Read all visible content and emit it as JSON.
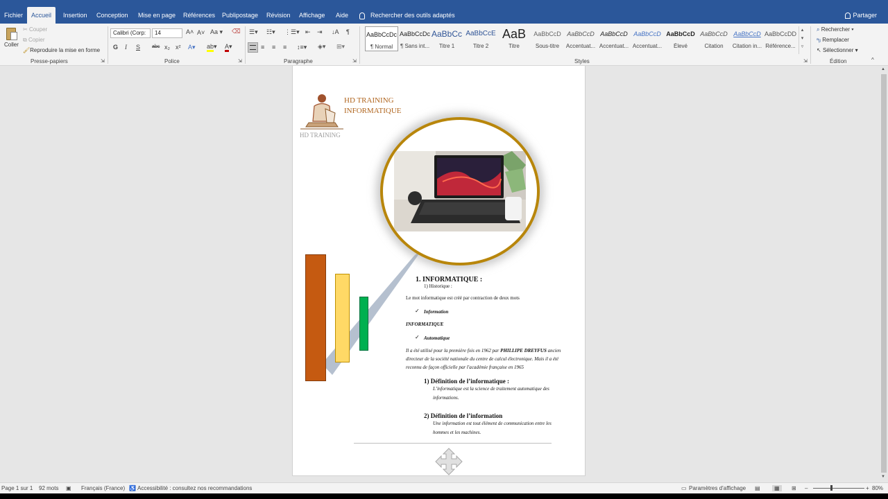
{
  "tabs": [
    "Fichier",
    "Accueil",
    "Insertion",
    "Conception",
    "Mise en page",
    "Références",
    "Publipostage",
    "Révision",
    "Affichage",
    "Aide"
  ],
  "tell_me": "Rechercher des outils adaptés",
  "share": "Partager",
  "clipboard": {
    "paste": "Coller",
    "cut": "Couper",
    "copy": "Copier",
    "format_painter": "Reproduire la mise en forme",
    "label": "Presse-papiers"
  },
  "font": {
    "name": "Calibri (Corp:",
    "size": "14",
    "bold": "G",
    "italic": "I",
    "underline": "S",
    "strike": "abc",
    "sub": "x₂",
    "sup": "x²",
    "case": "Aa",
    "label": "Police"
  },
  "paragraph": {
    "label": "Paragraphe"
  },
  "styles": {
    "label": "Styles",
    "items": [
      {
        "sample": "AaBbCcDc",
        "name": "¶ Normal"
      },
      {
        "sample": "AaBbCcDc",
        "name": "¶ Sans int..."
      },
      {
        "sample": "AaBbCc",
        "name": "Titre 1"
      },
      {
        "sample": "AaBbCcE",
        "name": "Titre 2"
      },
      {
        "sample": "AaB",
        "name": "Titre"
      },
      {
        "sample": "AaBbCcD",
        "name": "Sous-titre"
      },
      {
        "sample": "AaBbCcD",
        "name": "Accentuat..."
      },
      {
        "sample": "AaBbCcD",
        "name": "Accentuat..."
      },
      {
        "sample": "AaBbCcD",
        "name": "Accentuat..."
      },
      {
        "sample": "AaBbCcD",
        "name": "Élevé"
      },
      {
        "sample": "AaBbCcD",
        "name": "Citation"
      },
      {
        "sample": "AaBbCcD",
        "name": "Citation in..."
      },
      {
        "sample": "AaBbCcDD",
        "name": "Référence..."
      }
    ]
  },
  "editing": {
    "find": "Rechercher",
    "replace": "Remplacer",
    "select": "Sélectionner",
    "label": "Édition"
  },
  "document": {
    "logo_line1": "HD TRAINING",
    "logo_line2": "INFORMATIQUE",
    "logo_sub": "HD TRAINING",
    "heading1": "1.  INFORMATIQUE :",
    "sub1": "1)    Historique :",
    "para1": "Le mot informatique est créé par contraction de deux mots",
    "bullet1": "Information",
    "combined": "INFORMATIQUE",
    "bullet2": "Automatique",
    "para2_l1_a": "Il a été utilisé pour la première fois en 1962 par ",
    "para2_l1_b": "PHILLIPE DREYFUS",
    "para2_l1_c": " ancien",
    "para2_l2": "directeur de la société nationale du centre de calcul électronique. Mais il a été",
    "para2_l3": "reconnu de façon officielle par l'académie française en 1965",
    "def1_title": "1)  Définition de l’informatique :",
    "def1_l1": "L’informatique est la science de traitement automatique des",
    "def1_l2": "informations.",
    "def2_title": "2)  Définition de l’information",
    "def2_l1": "Une information est tout élément de communication entre les",
    "def2_l2": "hommes et les machines."
  },
  "status": {
    "page": "Page 1 sur 1",
    "words": "92 mots",
    "language": "Français (France)",
    "accessibility": "Accessibilité : consultez nos recommandations",
    "display_settings": "Paramètres d’affichage",
    "zoom": "80%"
  },
  "colors": {
    "brand_blue": "#2b579a",
    "bar_orange": "#c55a11",
    "bar_yellow": "#ffd966",
    "bar_green": "#00b050",
    "gold_ring": "#b8860b",
    "logo_text": "#b0651e"
  }
}
